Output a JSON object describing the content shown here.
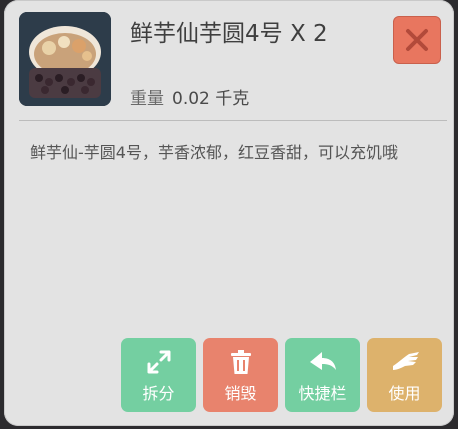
{
  "item": {
    "name": "鲜芋仙芋圆4号 X 2",
    "weight_label": "重量",
    "weight_value": "0.02 千克",
    "description": "鲜芋仙-芋圆4号，芋香浓郁，红豆香甜，可以充饥哦",
    "thumbnail_icon": "taro-dessert-bowl"
  },
  "actions": {
    "split_label": "拆分",
    "destroy_label": "销毁",
    "quickbar_label": "快捷栏",
    "use_label": "使用"
  },
  "colors": {
    "close": "#e8765f",
    "split": "#74cfa1",
    "destroy": "#e8836d",
    "quickbar": "#74cfa1",
    "use": "#ddb26c"
  }
}
